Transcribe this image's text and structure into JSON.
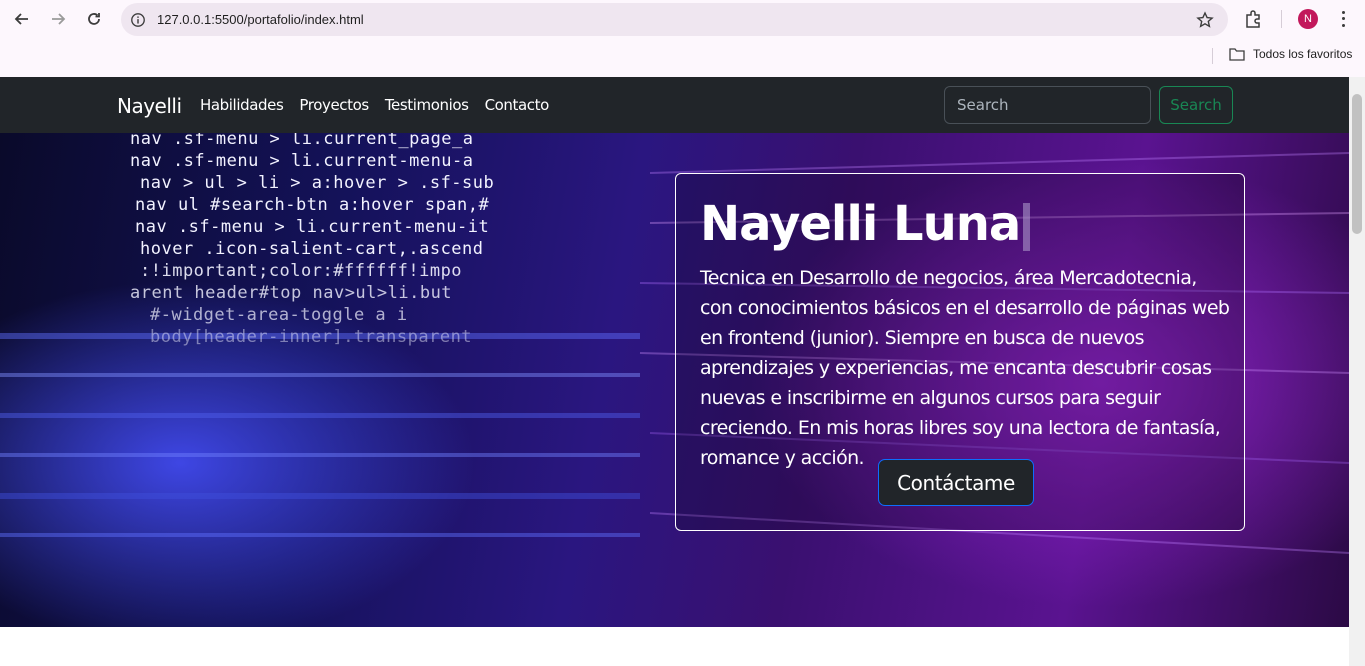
{
  "browser": {
    "url": "127.0.0.1:5500/portafolio/index.html",
    "profile_initial": "N",
    "bookmarks_folder": "Todos los favoritos"
  },
  "navbar": {
    "brand": "Nayelli",
    "links": [
      "Habilidades",
      "Proyectos",
      "Testimonios",
      "Contacto"
    ],
    "search_placeholder": "Search",
    "search_button": "Search"
  },
  "hero": {
    "title": "Nayelli Luna",
    "description": "Tecnica en Desarrollo de negocios, área Mercadotecnia, con conocimientos básicos en el desarrollo de páginas web en frontend (junior). Siempre en busca de nuevos aprendizajes y experiencias, me encanta descubrir cosas nuevas e inscribirme en algunos cursos para seguir creciendo. En mis horas libres soy una lectora de fantasía, romance y acción.",
    "cta": "Contáctame",
    "code_lines": [
      "nav .sf-menu > li.current_page_a",
      "nav .sf-menu > li.current-menu-a",
      "nav > ul > li > a:hover > .sf-sub",
      "nav ul #search-btn a:hover span,#",
      "nav .sf-menu > li.current-menu-it",
      "hover .icon-salient-cart,.ascend",
      ":!important;color:#ffffff!impo",
      "arent header#top nav>ul>li.but",
      "#-widget-area-toggle a i",
      "body[header-inner].transparent"
    ]
  },
  "colors": {
    "navbar_bg": "#212529",
    "search_accent": "#198754",
    "cta_border": "#0d6efd",
    "chrome_bg": "#fdf7fd"
  }
}
